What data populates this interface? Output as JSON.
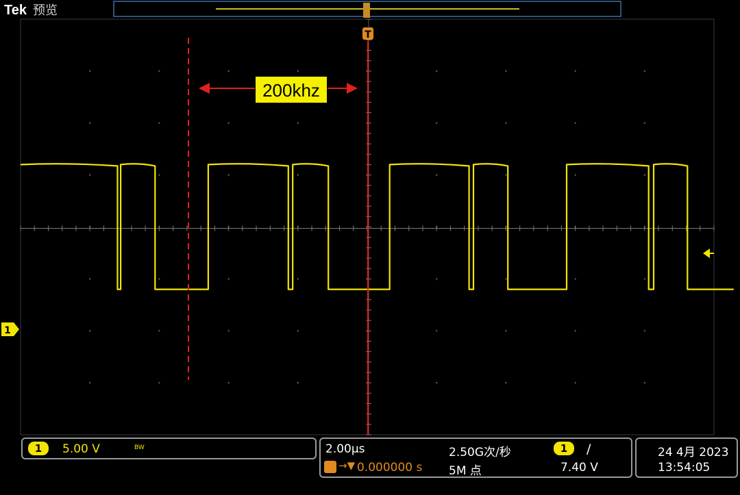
{
  "header": {
    "brand": "Tek",
    "mode": "预览",
    "trigger_marker": "T"
  },
  "waveform": {
    "color": "#f2e600",
    "high_level_div": 1.6,
    "low_level_div": -1.6,
    "segments_div": [
      [
        0.0,
        1.55,
        "high"
      ],
      [
        1.55,
        1.6,
        "low"
      ],
      [
        1.6,
        2.15,
        "high"
      ],
      [
        2.15,
        3.0,
        "low"
      ],
      [
        3.0,
        4.28,
        "high"
      ],
      [
        4.28,
        4.35,
        "low"
      ],
      [
        4.35,
        4.92,
        "high"
      ],
      [
        4.92,
        5.9,
        "low"
      ],
      [
        5.9,
        7.17,
        "high"
      ],
      [
        7.17,
        7.24,
        "low"
      ],
      [
        7.24,
        7.79,
        "high"
      ],
      [
        7.79,
        8.73,
        "low"
      ],
      [
        8.73,
        10.04,
        "high"
      ],
      [
        10.04,
        10.12,
        "low"
      ],
      [
        10.12,
        10.66,
        "high"
      ],
      [
        10.66,
        11.4,
        "low"
      ]
    ]
  },
  "annotation": {
    "label": "200khz",
    "label_bg": "#f5f000",
    "cursor_color": "#e02020"
  },
  "channel": {
    "marker": "1",
    "scale": "5.00 V",
    "bw_icon": "BW"
  },
  "timebase": {
    "scale": "2.00µs",
    "position": "0.000000 s",
    "sample_rate": "2.50G次/秒",
    "record_length": "5M 点"
  },
  "trigger": {
    "source": "1",
    "slope": "/",
    "level": "7.40 V"
  },
  "clock": {
    "date": "24 4月 2023",
    "time": "13:54:05"
  }
}
